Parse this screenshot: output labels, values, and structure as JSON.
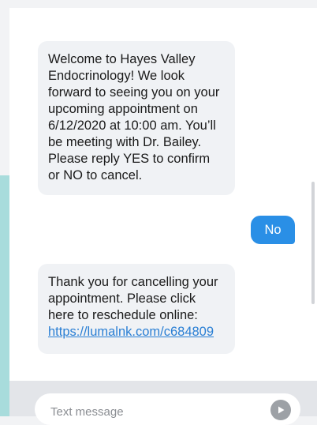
{
  "messages": [
    {
      "direction": "incoming",
      "text": "Welcome to Hayes Valley Endocrinology! We look forward to seeing you on your upcoming appointment on 6/12/2020 at 10:00 am. You’ll be meeting with Dr. Bailey. Please reply YES to confirm or NO to cancel."
    },
    {
      "direction": "outgoing",
      "text": "No"
    },
    {
      "direction": "incoming",
      "text": "Thank you for cancelling your appointment. Please click here to reschedule online:",
      "link": "https://lumalnk.com/c684809"
    }
  ],
  "composer": {
    "placeholder": "Text message",
    "send_icon": "send-arrow-icon"
  },
  "colors": {
    "outgoing_bubble": "#2a8fe6",
    "incoming_bubble": "#f0f2f5",
    "link": "#2a7fd4",
    "accent_strip": "#a8dcdc"
  }
}
